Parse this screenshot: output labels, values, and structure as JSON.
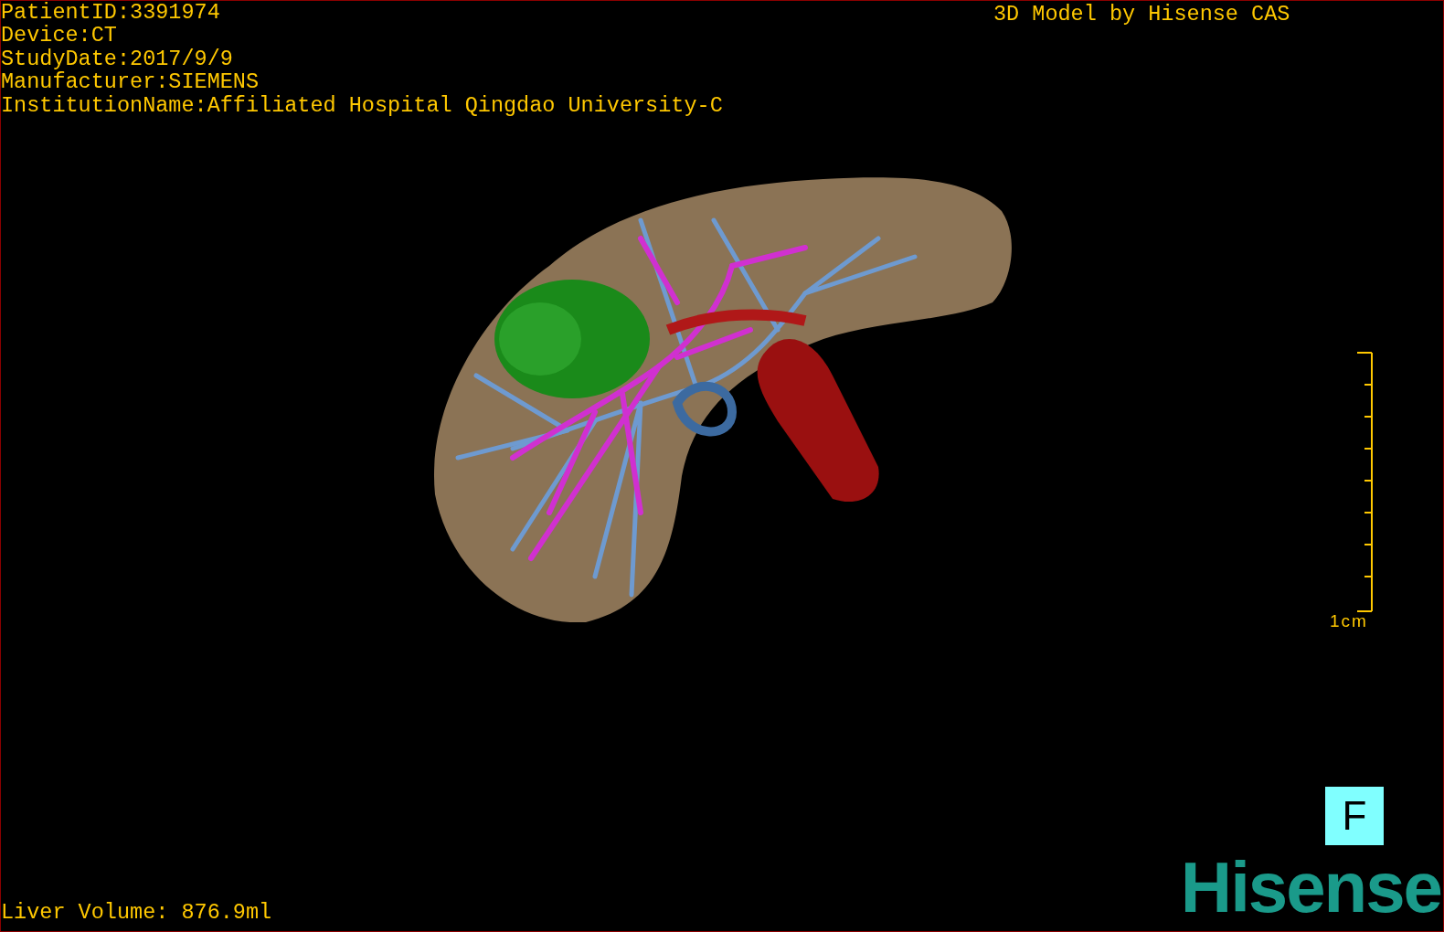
{
  "header_info": [
    "PatientID:3391974",
    "Device:CT",
    "StudyDate:2017/9/9",
    "Manufacturer:SIEMENS",
    "InstitutionName:Affiliated Hospital Qingdao University-C"
  ],
  "model_credit": "3D Model by Hisense CAS",
  "scale_bar": {
    "label": "1cm"
  },
  "orientation_marker": "F",
  "liver_volume": "Liver Volume: 876.9ml",
  "logo": "Hisense"
}
